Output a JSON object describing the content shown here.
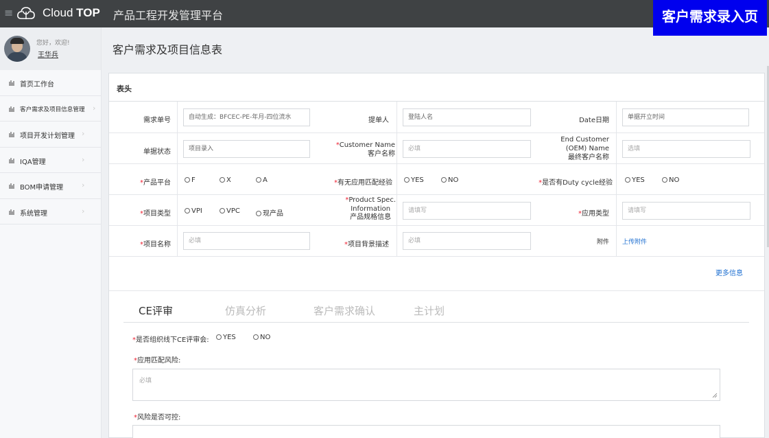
{
  "topbar": {
    "brand_prefix": "Cloud",
    "brand_bold": "TOP",
    "system_title": "产品工程开发管理平台",
    "page_badge": "客户需求录入页"
  },
  "user": {
    "greeting": "您好，欢迎!",
    "name": "王华兵"
  },
  "sidebar": {
    "items": [
      {
        "label": "首页工作台",
        "icon": "chart-icon"
      },
      {
        "label": "客户需求及项目信息管理",
        "icon": "chart-icon"
      },
      {
        "label": "项目开发计划管理",
        "icon": "chart-icon"
      },
      {
        "label": "IQA管理",
        "icon": "chart-icon"
      },
      {
        "label": "BOM申请管理",
        "icon": "chart-icon"
      },
      {
        "label": "系统管理",
        "icon": "chart-icon"
      }
    ]
  },
  "page_title": "客户需求及项目信息表",
  "panel": {
    "header": "表头",
    "rows": {
      "r1": {
        "l1": "需求单号",
        "v1": "自动生成：BFCEC-PE-年月-四位流水",
        "l2": "提单人",
        "v2": "登陆人名",
        "l3": "Date日期",
        "v3": "单据开立时间"
      },
      "r2": {
        "l1": "单据状态",
        "v1": "项目录入",
        "l2a": "Customer Name",
        "l2b": "客户名称",
        "v2": "必填",
        "l3a": "End Customer",
        "l3b": "(OEM) Name",
        "l3c": "最终客户名称",
        "v3": "选填"
      },
      "r3": {
        "l1": "产品平台",
        "opts1": [
          "F",
          "X",
          "A"
        ],
        "l2": "有无应用匹配经验",
        "opts2": [
          "YES",
          "NO"
        ],
        "l3": "是否有Duty cycle经验",
        "opts3": [
          "YES",
          "NO"
        ]
      },
      "r4": {
        "l1": "项目类型",
        "opts1": [
          "VPI",
          "VPC",
          "现产品"
        ],
        "l2a": "Product Spec.",
        "l2b": "Information",
        "l2c": "产品规格信息",
        "v2": "请填写",
        "l3": "应用类型",
        "v3": "请填写"
      },
      "r5": {
        "l1": "项目名称",
        "v1": "必填",
        "l2": "项目背景描述",
        "v2": "必填",
        "l3": "附件",
        "v3": "上传附件"
      }
    },
    "more_link": "更多信息",
    "tabs": [
      "CE评审",
      "仿真分析",
      "客户需求确认",
      "主计划"
    ],
    "active_tab": "CE评审",
    "ce": {
      "q1": "是否组织线下CE评审会:",
      "q1_opts": [
        "YES",
        "NO"
      ],
      "q2": "应用匹配风险:",
      "q2_placeholder": "必填",
      "q3": "风险是否可控:"
    }
  }
}
